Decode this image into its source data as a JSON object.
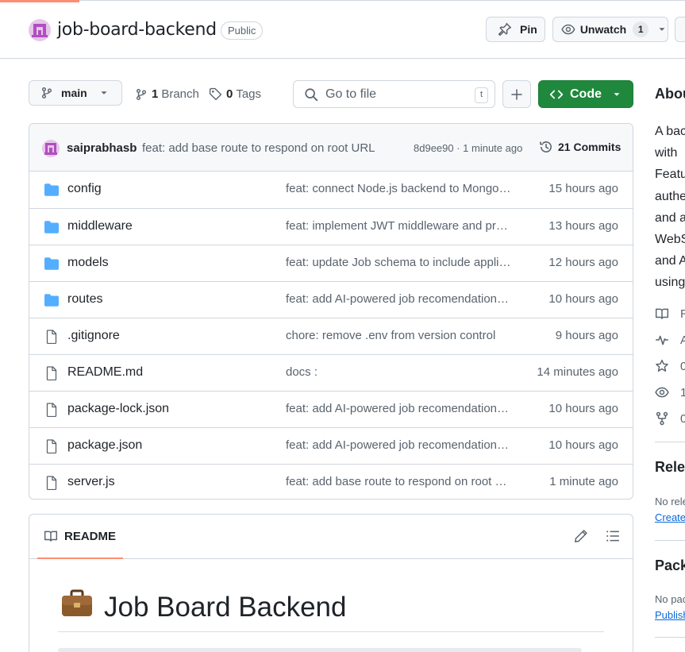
{
  "repo": {
    "name": "job-board-backend",
    "visibility": "Public"
  },
  "actions": {
    "pin_label": "Pin",
    "unwatch_label": "Unwatch",
    "watch_count": "1"
  },
  "toolbar": {
    "branch_name": "main",
    "branches_count": "1",
    "branches_label": "Branch",
    "tags_count": "0",
    "tags_label": "Tags",
    "goto_placeholder": "Go to file",
    "goto_shortcut": "t",
    "code_label": "Code"
  },
  "latest_commit": {
    "author": "saiprabhasb",
    "message": "feat: add base route to respond on root URL",
    "meta": "8d9ee90 · 1 minute ago",
    "commits_label": "21 Commits"
  },
  "files": [
    {
      "name": "config",
      "type": "folder",
      "message": "feat: connect Node.js backend to MongoDB",
      "time": "15 hours ago"
    },
    {
      "name": "middleware",
      "type": "folder",
      "message": "feat: implement JWT middleware and protected routes",
      "time": "13 hours ago"
    },
    {
      "name": "models",
      "type": "folder",
      "message": "feat: update Job schema to include applicants",
      "time": "12 hours ago"
    },
    {
      "name": "routes",
      "type": "folder",
      "message": "feat: add AI-powered job recomendation route",
      "time": "10 hours ago"
    },
    {
      "name": ".gitignore",
      "type": "file",
      "message": "chore: remove .env from version control",
      "time": "9 hours ago"
    },
    {
      "name": "README.md",
      "type": "file",
      "message": "docs :",
      "time": "14 minutes ago"
    },
    {
      "name": "package-lock.json",
      "type": "file",
      "message": "feat: add AI-powered job recomendation route",
      "time": "10 hours ago"
    },
    {
      "name": "package.json",
      "type": "file",
      "message": "feat: add AI-powered job recomendation route",
      "time": "10 hours ago"
    },
    {
      "name": "server.js",
      "type": "file",
      "message": "feat: add base route to respond on root URL",
      "time": "1 minute ago"
    }
  ],
  "readme": {
    "tab_label": "README",
    "emoji": "💼",
    "title": "Job Board Backend"
  },
  "sidebar": {
    "about_heading": "Abou",
    "description_lines": [
      "A bac",
      "with",
      "Featu",
      "authe",
      "and a",
      "WebS",
      "and A",
      "using"
    ],
    "stats": [
      {
        "icon": "book-icon",
        "label": "R"
      },
      {
        "icon": "pulse-icon",
        "label": "A"
      },
      {
        "icon": "star-icon",
        "label": "0"
      },
      {
        "icon": "eye-icon",
        "label": "1"
      },
      {
        "icon": "fork-icon",
        "label": "0"
      }
    ],
    "releases_heading": "Relea",
    "releases_text": "No rele",
    "releases_link": "Create",
    "packages_heading": "Pack",
    "packages_text": "No pac",
    "packages_link": "Publish"
  },
  "colors": {
    "accent_green": "#1f883d",
    "folder_blue": "#54aeff",
    "tab_underline": "#fd8c73",
    "link_blue": "#0969da"
  }
}
